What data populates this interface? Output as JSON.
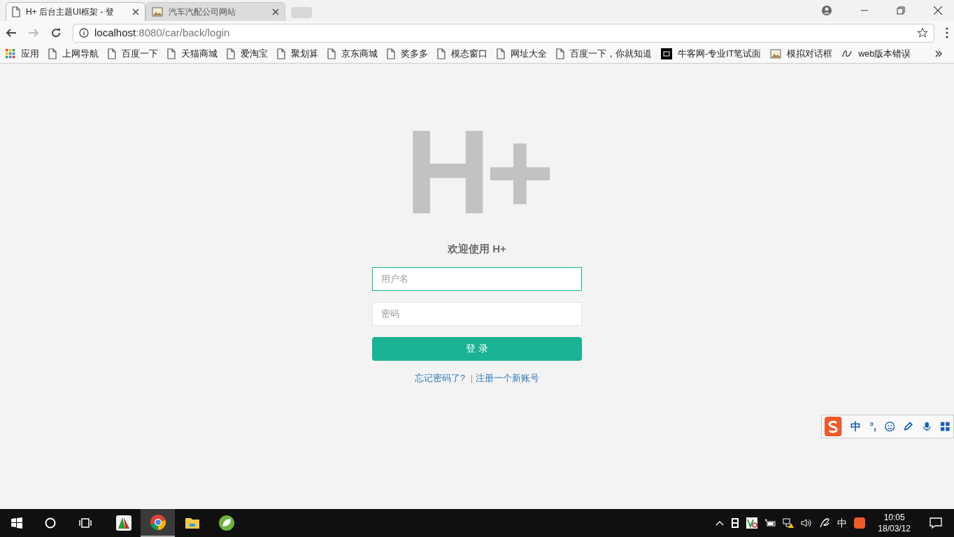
{
  "tabs": [
    {
      "title": "H+ 后台主题UI框架 - 登",
      "kind": "page",
      "selected": true
    },
    {
      "title": "汽车汽配公司网站",
      "kind": "image",
      "selected": false
    }
  ],
  "address": {
    "host": "localhost",
    "path": ":8080/car/back/login"
  },
  "bookmarks": [
    {
      "label": "应用",
      "kind": "apps"
    },
    {
      "label": "上网导航",
      "kind": "page"
    },
    {
      "label": "百度一下",
      "kind": "page"
    },
    {
      "label": "天猫商城",
      "kind": "page"
    },
    {
      "label": "爱淘宝",
      "kind": "page"
    },
    {
      "label": "聚划算",
      "kind": "page"
    },
    {
      "label": "京东商城",
      "kind": "page"
    },
    {
      "label": "奖多多",
      "kind": "page"
    },
    {
      "label": "模态窗口",
      "kind": "page"
    },
    {
      "label": "网址大全",
      "kind": "page"
    },
    {
      "label": "百度一下，你就知道",
      "kind": "page"
    },
    {
      "label": "牛客网-专业IT笔试面",
      "kind": "logo"
    },
    {
      "label": "模拟对话框",
      "kind": "image"
    },
    {
      "label": "web版本错误",
      "kind": "script"
    }
  ],
  "login": {
    "logo": "H+",
    "heading": "欢迎使用 H+",
    "username": {
      "placeholder": "用户名",
      "focused": true
    },
    "password": {
      "placeholder": "密码",
      "focused": false
    },
    "submit": "登 录",
    "forgot": "忘记密码了?",
    "separator": "|",
    "register": "注册一个新账号"
  },
  "ime_toolbar": {
    "mode": "中",
    "punctuation": "°,"
  },
  "taskbar": {
    "apps": [
      {
        "kind": "app",
        "selected": false
      },
      {
        "kind": "browser",
        "selected": true
      },
      {
        "kind": "folder",
        "selected": false
      },
      {
        "kind": "leaf",
        "selected": false
      }
    ],
    "input_mode": "中",
    "time": "10:05",
    "date": "18/03/12"
  }
}
